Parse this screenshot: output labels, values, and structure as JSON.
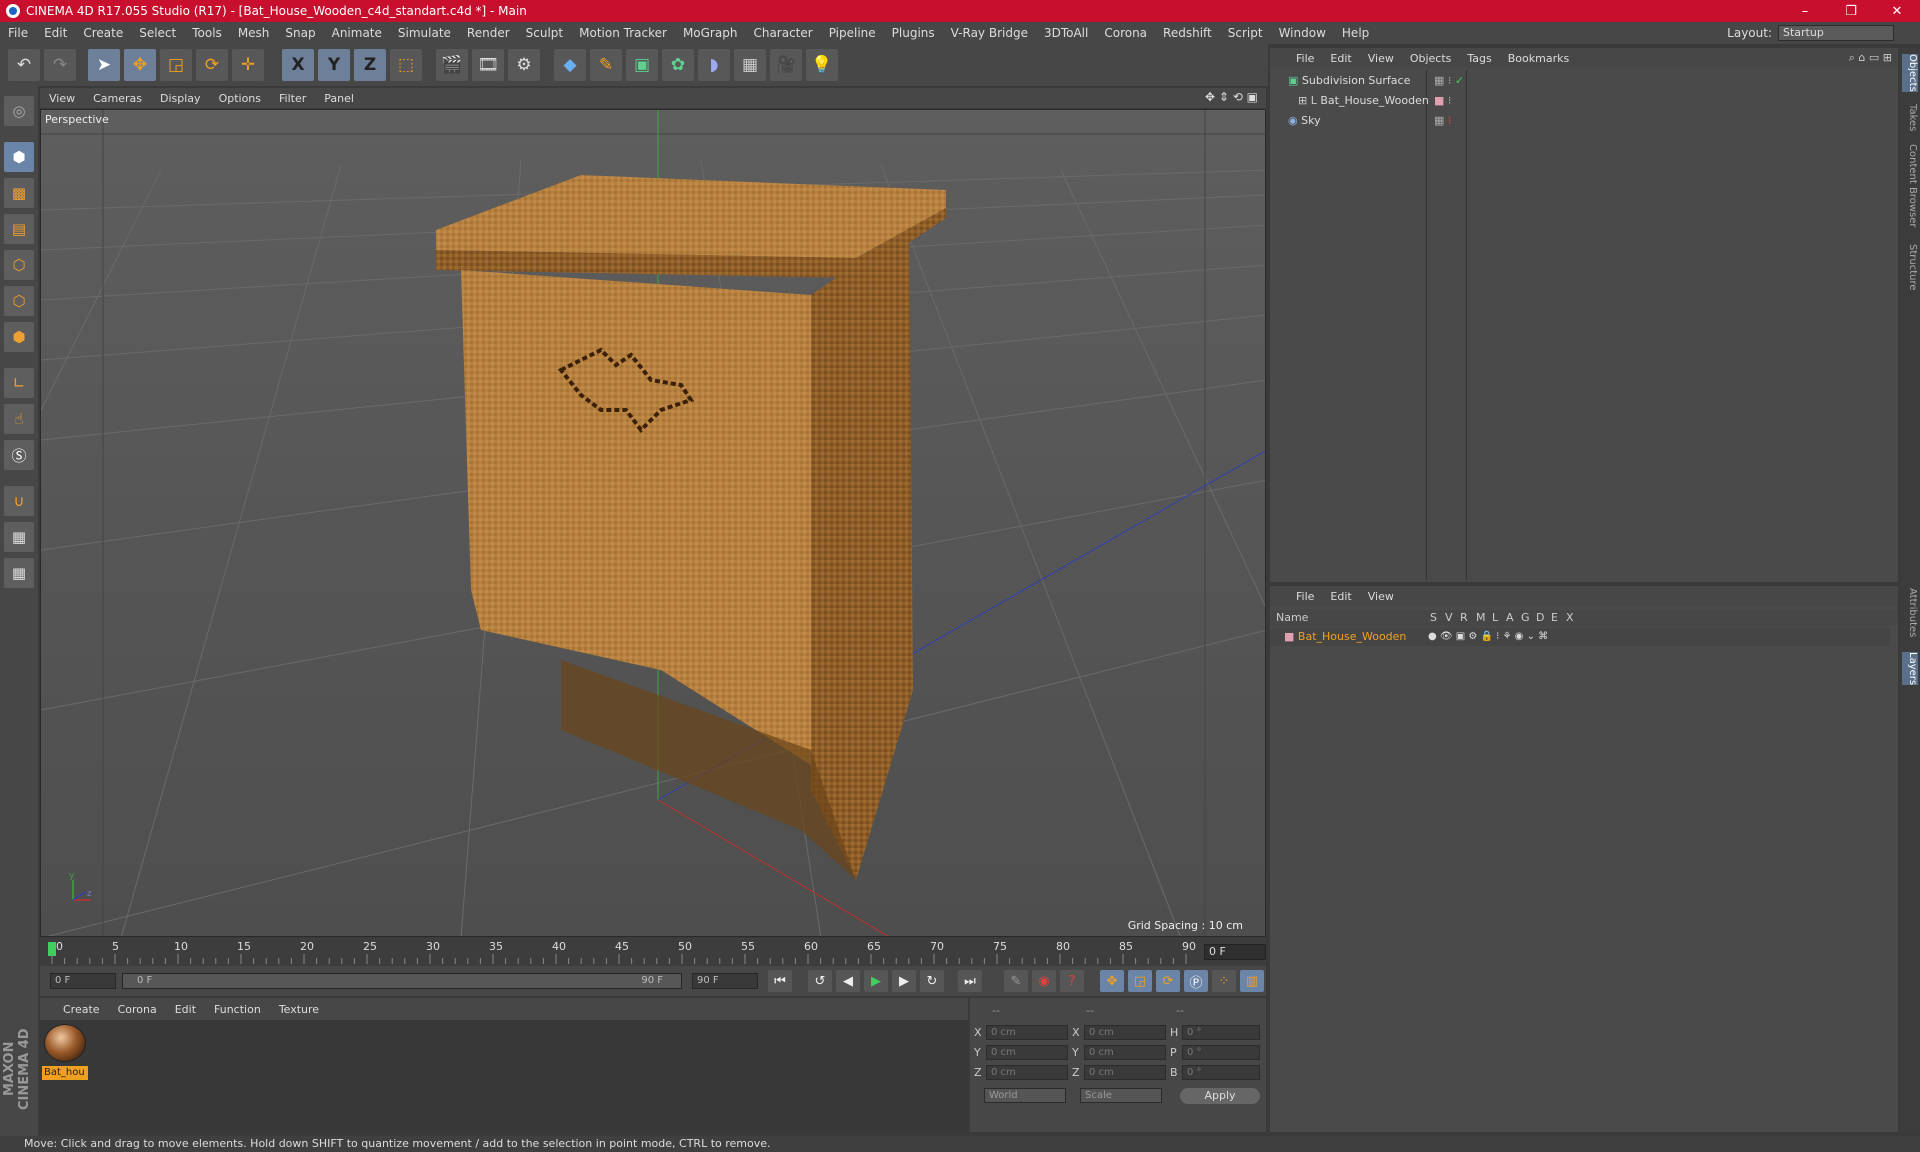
{
  "window": {
    "title": "CINEMA 4D R17.055 Studio (R17) - [Bat_House_Wooden_c4d_standart.c4d *] - Main",
    "controls": [
      "–",
      "❐",
      "✕"
    ]
  },
  "menubar": {
    "items": [
      "File",
      "Edit",
      "Create",
      "Select",
      "Tools",
      "Mesh",
      "Snap",
      "Animate",
      "Simulate",
      "Render",
      "Sculpt",
      "Motion Tracker",
      "MoGraph",
      "Character",
      "Pipeline",
      "Plugins",
      "V-Ray Bridge",
      "3DToAll",
      "Corona",
      "Redshift",
      "Script",
      "Window",
      "Help"
    ],
    "layout_label": "Layout:",
    "layout_value": "Startup"
  },
  "toolbar": {
    "icons": [
      "undo-icon",
      "redo-icon",
      "select-arrow-icon",
      "move-icon",
      "scale-icon",
      "rotate-icon",
      "last-tool-icon",
      "x-axis-icon",
      "y-axis-icon",
      "z-axis-icon",
      "world-coords-icon",
      "render-view-icon",
      "render-picture-viewer-icon",
      "edit-render-settings-icon",
      "cube-primitive-icon",
      "pen-spline-icon",
      "subdivision-icon",
      "mograph-cloner-icon",
      "deformer-icon",
      "floor-icon",
      "camera-icon",
      "light-icon"
    ],
    "axis_labels": [
      "X",
      "Y",
      "Z"
    ]
  },
  "viewport": {
    "menu": [
      "View",
      "Cameras",
      "Display",
      "Options",
      "Filter",
      "Panel"
    ],
    "label": "Perspective",
    "grid_spacing": "Grid Spacing : 10 cm"
  },
  "timeline": {
    "ticks": [
      "0",
      "5",
      "10",
      "15",
      "20",
      "25",
      "30",
      "35",
      "40",
      "45",
      "50",
      "55",
      "60",
      "65",
      "70",
      "75",
      "80",
      "85",
      "90"
    ],
    "current_frame": "0 F"
  },
  "transport": {
    "start_field": "0 F",
    "range_start": "0 F",
    "range_end": "90 F",
    "end_field": "90 F"
  },
  "material_manager": {
    "menu": [
      "Create",
      "Corona",
      "Edit",
      "Function",
      "Texture"
    ],
    "materials": [
      {
        "name": "Bat_hou"
      }
    ]
  },
  "coordinates": {
    "header": [
      "--",
      "--",
      "--"
    ],
    "rows": [
      {
        "axis1": "X",
        "val1": "0 cm",
        "axis2": "X",
        "val2": "0 cm",
        "axis3": "H",
        "val3": "0 °"
      },
      {
        "axis1": "Y",
        "val1": "0 cm",
        "axis2": "Y",
        "val2": "0 cm",
        "axis3": "P",
        "val3": "0 °"
      },
      {
        "axis1": "Z",
        "val1": "0 cm",
        "axis2": "Z",
        "val2": "0 cm",
        "axis3": "B",
        "val3": "0 °"
      }
    ],
    "mode_select": "World",
    "size_select": "Scale",
    "apply_label": "Apply"
  },
  "object_manager": {
    "menu": [
      "File",
      "Edit",
      "View",
      "Objects",
      "Tags",
      "Bookmarks"
    ],
    "objects": [
      {
        "name": "Subdivision Surface",
        "indent": 0
      },
      {
        "name": "Bat_House_Wooden",
        "indent": 1
      },
      {
        "name": "Sky",
        "indent": 0
      }
    ]
  },
  "layer_manager": {
    "menu": [
      "File",
      "Edit",
      "View"
    ],
    "columns": [
      "Name",
      "S",
      "V",
      "R",
      "M",
      "L",
      "A",
      "G",
      "D",
      "E",
      "X"
    ],
    "layers": [
      {
        "name": "Bat_House_Wooden",
        "color": "#f0a020"
      }
    ]
  },
  "right_tabs": [
    "Objects",
    "Takes",
    "Content Browser",
    "Structure",
    "Attributes",
    "Layers"
  ],
  "status": {
    "text": "Move: Click and drag to move elements. Hold down SHIFT to quantize movement / add to the selection in point mode, CTRL to remove."
  },
  "branding": {
    "maxon": "MAXON CINEMA 4D"
  },
  "colors": {
    "title_bar": "#c8102e",
    "accent_orange": "#f0a020",
    "accent_blue": "#6b85a8"
  }
}
